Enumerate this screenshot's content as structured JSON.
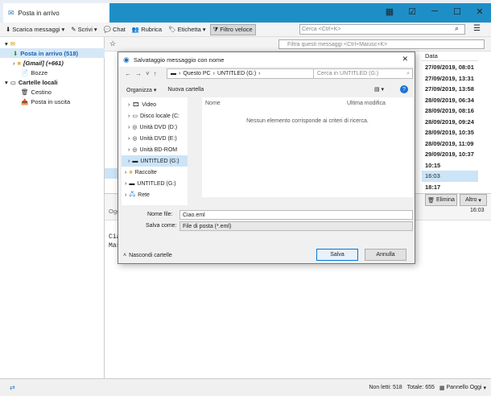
{
  "app": {
    "tab_title": "Posta in arrivo"
  },
  "toolbar": {
    "items": [
      "Scarica messaggi",
      "Scrivi",
      "Chat",
      "Rubrica",
      "Etichetta",
      "Filtro veloce"
    ],
    "search_placeholder": "Cerca <Ctrl+K>"
  },
  "filter_placeholder": "Filtra questi messaggi <Ctrl+Maiusc+K>",
  "sidebar": {
    "items": [
      {
        "label": "Posta in arrivo (518)"
      },
      {
        "label": "[Gmail] (+661)"
      },
      {
        "label": "Bozze"
      },
      {
        "label": "Cartelle locali"
      },
      {
        "label": "Cestino"
      },
      {
        "label": "Posta in uscita"
      }
    ]
  },
  "messages": {
    "date_header": "Data",
    "dates": [
      "27/09/2019, 08:01",
      "27/09/2019, 13:31",
      "27/09/2019, 13:58",
      "28/09/2019, 06:34",
      "28/09/2019, 08:16",
      "28/09/2019, 09:24",
      "28/09/2019, 10:35",
      "28/09/2019, 11:09",
      "29/09/2019, 10:37",
      "10:15",
      "16:03",
      "18:17"
    ]
  },
  "preview": {
    "actions": [
      "Elimina",
      "Altro"
    ],
    "from_short": "Ogg",
    "time": "16:03",
    "body_lines": [
      "Cia",
      "Mar"
    ]
  },
  "dialog": {
    "title": "Salvataggio messaggio con nome",
    "path": [
      "Questo PC",
      "UNTITLED (G:)"
    ],
    "search_placeholder": "Cerca in UNTITLED (G:)",
    "organize": "Organizza",
    "new_folder": "Nuova cartella",
    "col_name": "Nome",
    "col_modified": "Ultima modifica",
    "empty_msg": "Nessun elemento corrisponde ai criteri di ricerca.",
    "nav": [
      "Video",
      "Disco locale (C:",
      "Unità DVD (D:)",
      "Unità DVD (E:)",
      "Unità BD-ROM",
      "UNTITLED (G:)",
      "Raccolte",
      "UNTITLED (G:)",
      "Rete"
    ],
    "filename_label": "Nome file:",
    "filename": "Ciao.eml",
    "saveas_label": "Salva come:",
    "saveas": "File di posta (*.eml)",
    "hide_folders": "Nascondi cartelle",
    "save": "Salva",
    "cancel": "Annulla"
  },
  "statusbar": {
    "unread": "Non letti: 518",
    "total": "Totale: 655",
    "panel": "Pannello Oggi"
  },
  "colors": {
    "accent": "#1e8fc6",
    "selection": "#cce4f7"
  }
}
